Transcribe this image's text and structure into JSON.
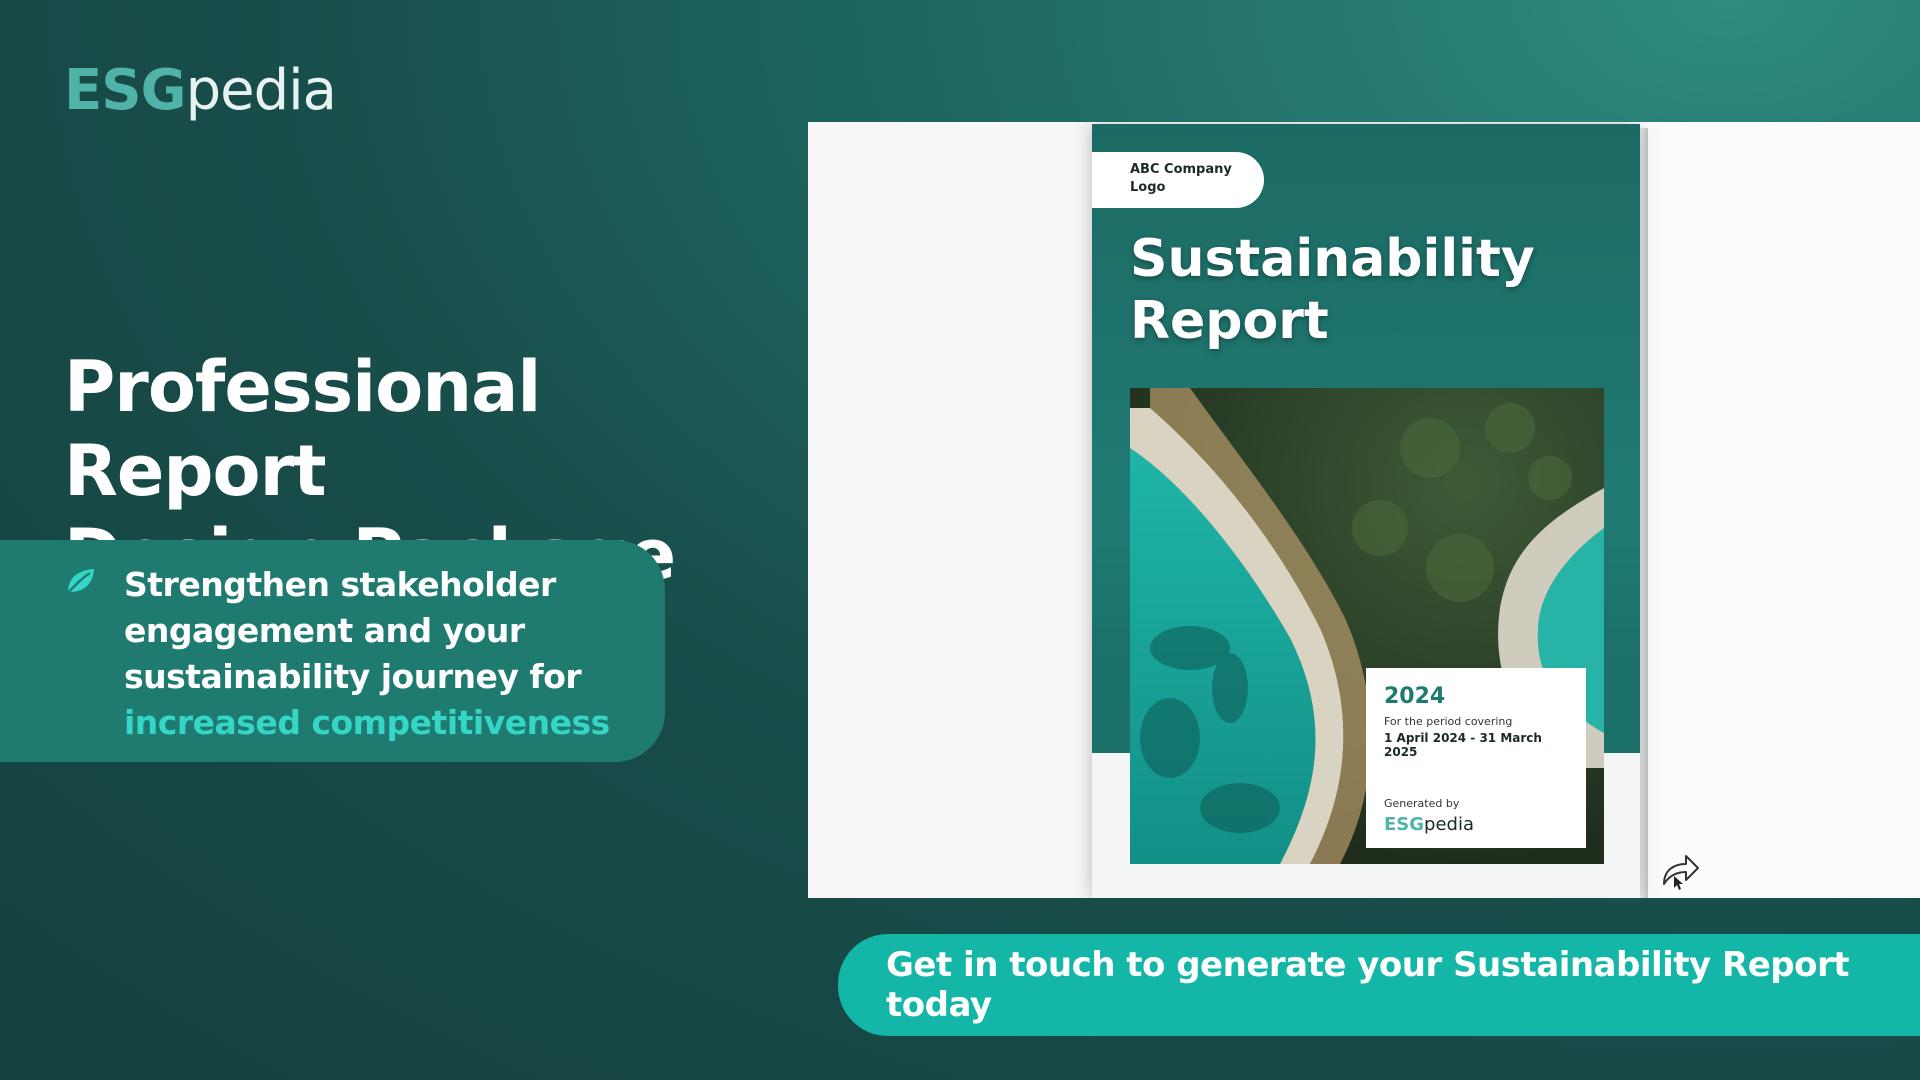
{
  "brand": {
    "esg": "ESG",
    "pedia": "pedia"
  },
  "headline": {
    "line1": "Professional Report",
    "line2": "Design Package"
  },
  "bullet": {
    "line1": "Strengthen stakeholder",
    "line2": "engagement and your",
    "line3": "sustainability journey for",
    "highlight": "increased competitiveness",
    "icon": "leaf-icon"
  },
  "report_cover": {
    "company_logo_line1": "ABC Company",
    "company_logo_line2": "Logo",
    "title_line1": "Sustainability",
    "title_line2": "Report",
    "year": "2024",
    "period_label": "For the period covering",
    "period_dates": "1 April 2024 - 31 March 2025",
    "generated_by": "Generated by",
    "brand_esg": "ESG",
    "brand_pedia": "pedia"
  },
  "cta": {
    "label": "Get in touch to generate your Sustainability Report today"
  },
  "colors": {
    "accent": "#35d6c6",
    "cta_bg": "#14b6a7",
    "card_bg": "#1f7a70",
    "brand_teal": "#4fb3a8"
  }
}
